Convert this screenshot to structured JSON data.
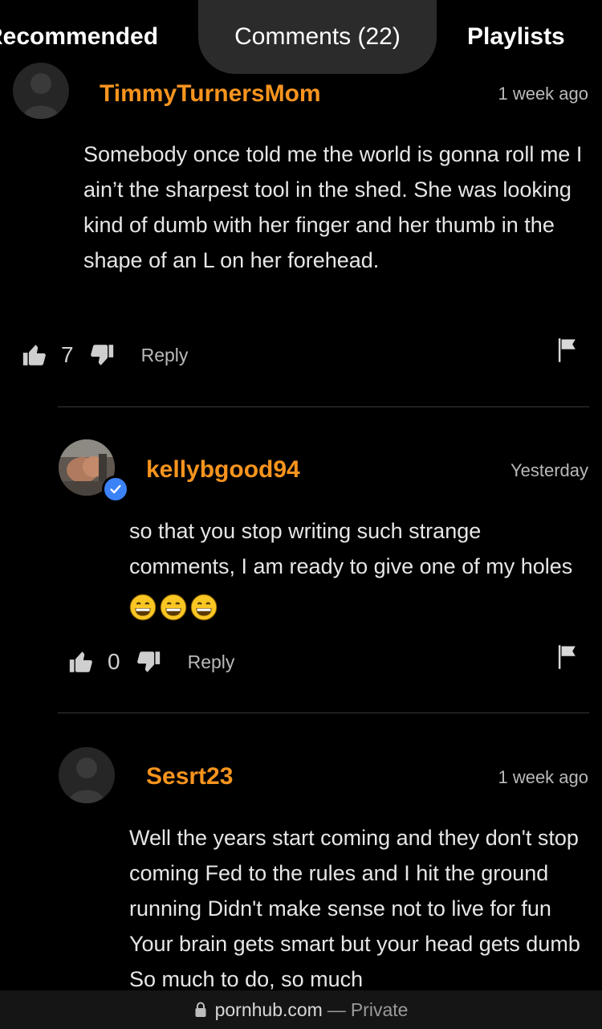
{
  "tabs": {
    "recommended": "Recommended",
    "comments": "Comments (22)",
    "playlists": "Playlists"
  },
  "comments": [
    {
      "author": "TimmyTurnersMom",
      "time": "1 week ago",
      "body": "Somebody once told me the world is gonna roll me I ain’t the sharpest tool in the shed. She was looking kind of dumb with her finger and her thumb in the shape of an L on her forehead.",
      "likes": "7",
      "reply": "Reply"
    },
    {
      "author": "kellybgood94",
      "time": "Yesterday",
      "body": "so that you stop writing such strange comments, I am ready to give one of my holes",
      "emoji": "😄😄😄",
      "likes": "0",
      "reply": "Reply",
      "verified": true
    },
    {
      "author": "Sesrt23",
      "time": "1 week ago",
      "body": "Well the years start coming and they don't stop coming Fed to the rules and I hit the ground running Didn't make sense not to live for fun Your brain gets smart but your head gets dumb So much to do, so much"
    }
  ],
  "urlbar": {
    "domain": "pornhub.com",
    "separator": "—",
    "mode": "Private"
  },
  "colors": {
    "background": "#000000",
    "author": "#f7941e",
    "tab_active_bg": "#2b2b2b",
    "verified": "#3b82f6"
  }
}
